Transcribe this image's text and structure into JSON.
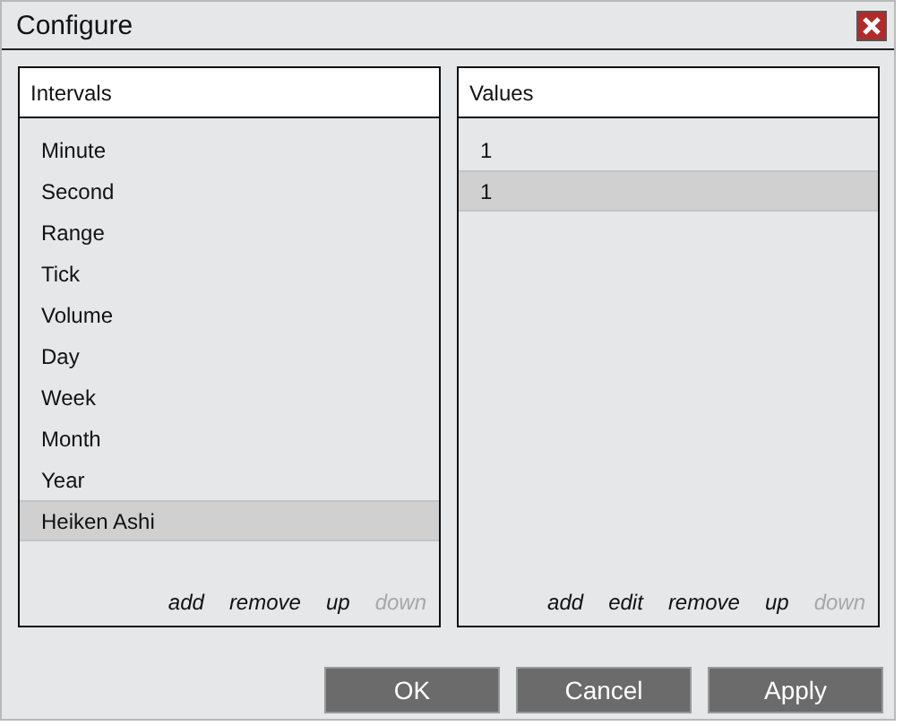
{
  "window": {
    "title": "Configure"
  },
  "intervals": {
    "title": "Intervals",
    "items": [
      {
        "label": "Minute",
        "selected": false
      },
      {
        "label": "Second",
        "selected": false
      },
      {
        "label": "Range",
        "selected": false
      },
      {
        "label": "Tick",
        "selected": false
      },
      {
        "label": "Volume",
        "selected": false
      },
      {
        "label": "Day",
        "selected": false
      },
      {
        "label": "Week",
        "selected": false
      },
      {
        "label": "Month",
        "selected": false
      },
      {
        "label": "Year",
        "selected": false
      },
      {
        "label": "Heiken Ashi",
        "selected": true
      }
    ],
    "actions": [
      {
        "label": "add",
        "disabled": false
      },
      {
        "label": "remove",
        "disabled": false
      },
      {
        "label": "up",
        "disabled": false
      },
      {
        "label": "down",
        "disabled": true
      }
    ]
  },
  "values": {
    "title": "Values",
    "items": [
      {
        "label": "1",
        "selected": false
      },
      {
        "label": "1",
        "selected": true
      }
    ],
    "actions": [
      {
        "label": "add",
        "disabled": false
      },
      {
        "label": "edit",
        "disabled": false
      },
      {
        "label": "remove",
        "disabled": false
      },
      {
        "label": "up",
        "disabled": false
      },
      {
        "label": "down",
        "disabled": true
      }
    ]
  },
  "buttons": [
    "OK",
    "Cancel",
    "Apply"
  ]
}
